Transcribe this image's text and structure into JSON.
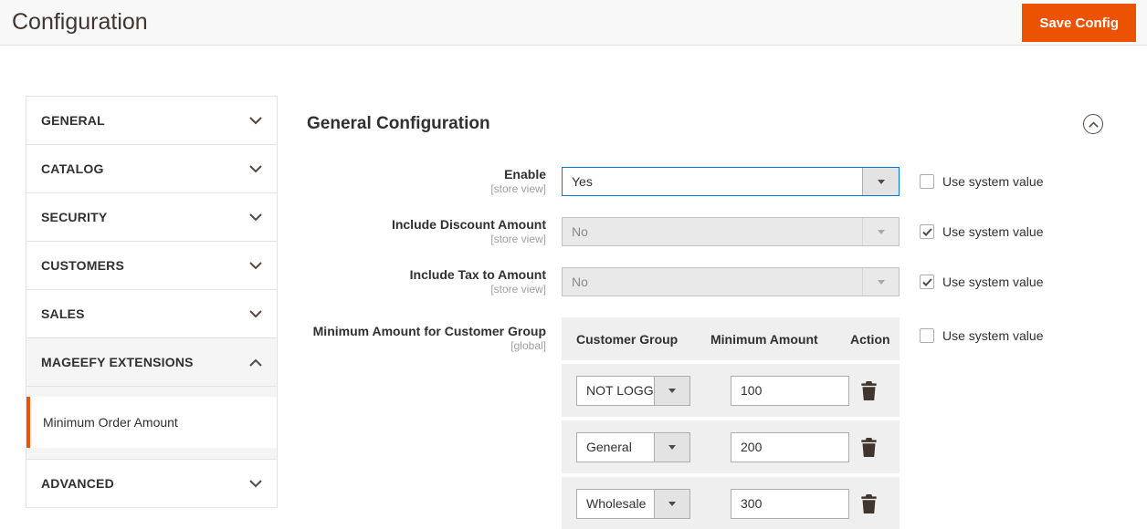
{
  "colors": {
    "accent_orange": "#eb5202",
    "focus_blue": "#007bdb",
    "header_bg": "#f8f8f8",
    "table_row_gray": "#efefef",
    "border_gray": "#e3e3e3",
    "text_dark": "#303030",
    "scope_gray": "#9e9e9e"
  },
  "icons": {
    "section_toggle_collapsed": "chevron-down",
    "section_toggle_expanded": "chevron-up",
    "panel_collapse": "chevron-up-circle",
    "select_arrow": "caret-down",
    "row_delete": "trash",
    "checkbox_check": "checkmark"
  },
  "header": {
    "title": "Configuration",
    "save_button_label": "Save Config"
  },
  "sidebar": {
    "sections": [
      {
        "label": "GENERAL",
        "expanded": false
      },
      {
        "label": "CATALOG",
        "expanded": false
      },
      {
        "label": "SECURITY",
        "expanded": false
      },
      {
        "label": "CUSTOMERS",
        "expanded": false
      },
      {
        "label": "SALES",
        "expanded": false
      },
      {
        "label": "MAGEEFY EXTENSIONS",
        "expanded": true
      },
      {
        "label": "ADVANCED",
        "expanded": false
      }
    ],
    "subitems": [
      {
        "label": "Minimum Order Amount",
        "active": true
      }
    ]
  },
  "main": {
    "section_title": "General Configuration",
    "use_system_label": "Use system value",
    "fields": [
      {
        "label": "Enable",
        "scope": "[store view]",
        "value": "Yes",
        "focused": true,
        "disabled": false,
        "use_system_checked": false
      },
      {
        "label": "Include Discount Amount",
        "scope": "[store view]",
        "value": "No",
        "focused": false,
        "disabled": true,
        "use_system_checked": true
      },
      {
        "label": "Include Tax to Amount",
        "scope": "[store view]",
        "value": "No",
        "focused": false,
        "disabled": true,
        "use_system_checked": true
      }
    ],
    "group_field": {
      "label": "Minimum Amount for Customer Group",
      "scope": "[global]",
      "use_system_checked": false,
      "table": {
        "headers": [
          "Customer Group",
          "Minimum Amount",
          "Action"
        ],
        "rows": [
          {
            "customer_group": "NOT LOGG",
            "minimum_amount": "100"
          },
          {
            "customer_group": "General",
            "minimum_amount": "200"
          },
          {
            "customer_group": "Wholesale",
            "minimum_amount": "300"
          }
        ]
      }
    }
  }
}
